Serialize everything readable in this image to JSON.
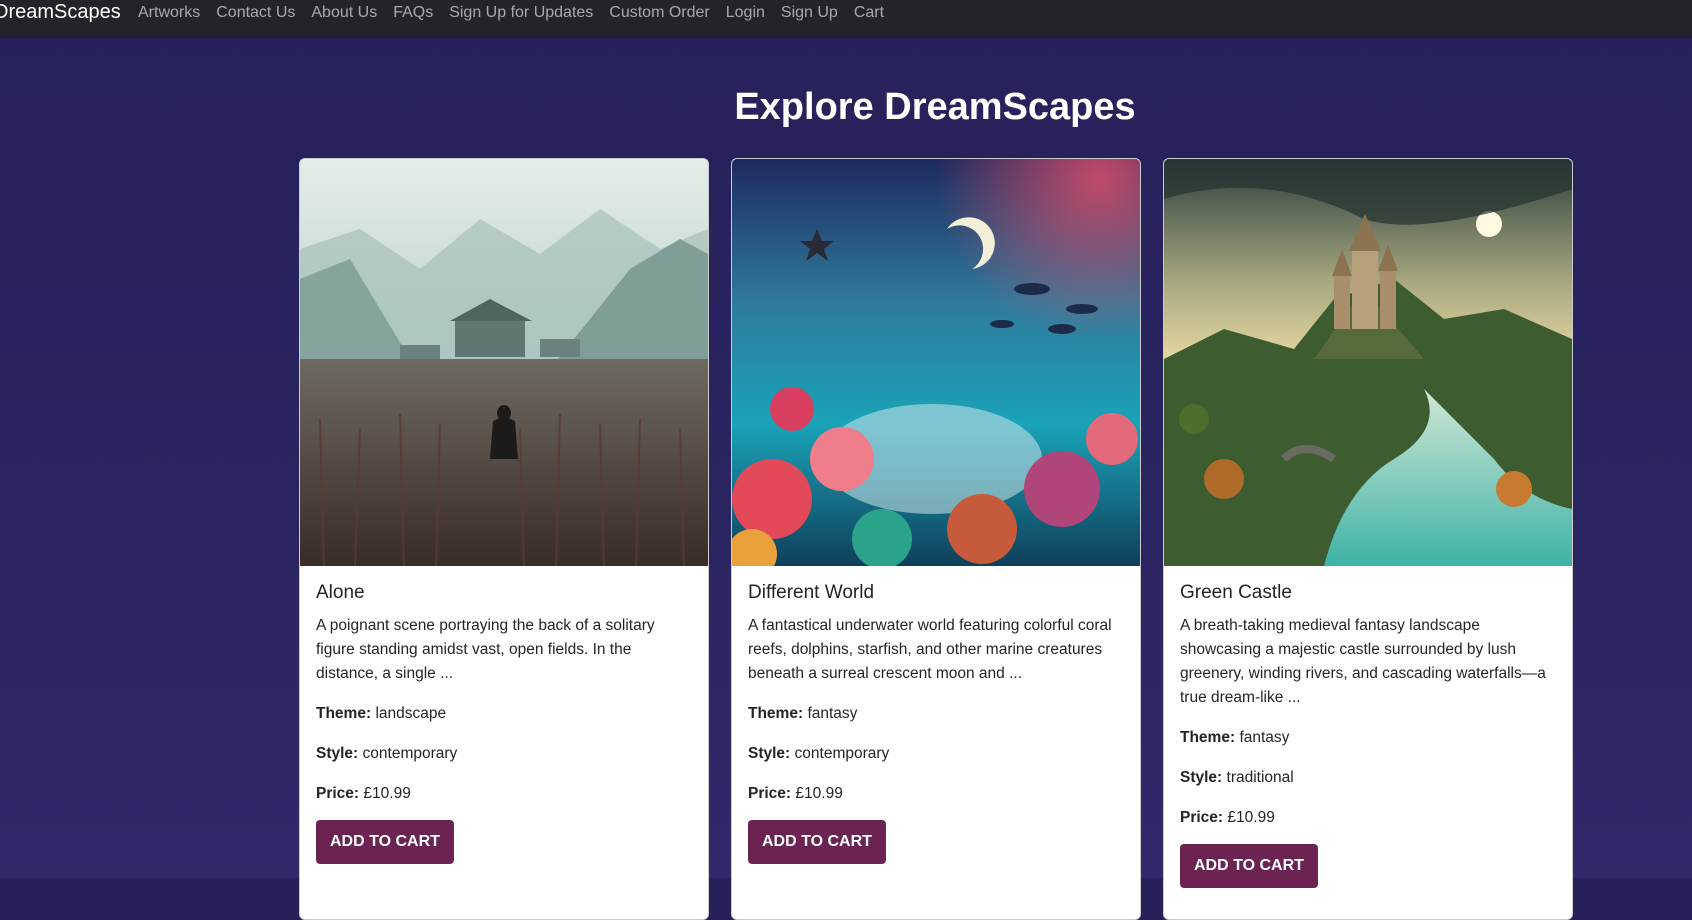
{
  "nav": {
    "brand": "DreamScapes",
    "links": [
      "Artworks",
      "Contact Us",
      "About Us",
      "FAQs",
      "Sign Up for Updates",
      "Custom Order",
      "Login",
      "Sign Up",
      "Cart"
    ]
  },
  "page": {
    "title": "Explore DreamScapes"
  },
  "labels": {
    "theme": "Theme:",
    "style": "Style:",
    "price": "Price:",
    "add_to_cart": "ADD TO CART"
  },
  "cards": [
    {
      "title": "Alone",
      "description": "A poignant scene portraying the back of a solitary figure standing amidst vast, open fields. In the distance, a single ...",
      "theme": "landscape",
      "style": "contemporary",
      "price": "£10.99"
    },
    {
      "title": "Different World",
      "description": "A fantastical underwater world featuring colorful coral reefs, dolphins, starfish, and other marine creatures beneath a surreal crescent moon and ...",
      "theme": "fantasy",
      "style": "contemporary",
      "price": "£10.99"
    },
    {
      "title": "Green Castle",
      "description": "A breath-taking medieval fantasy landscape showcasing a majestic castle surrounded by lush greenery, winding rivers, and cascading waterfalls—a true dream-like ...",
      "theme": "fantasy",
      "style": "traditional",
      "price": "£10.99"
    }
  ],
  "colors": {
    "navbar": "#212529",
    "background": "#27225b",
    "button": "#6b2351"
  }
}
